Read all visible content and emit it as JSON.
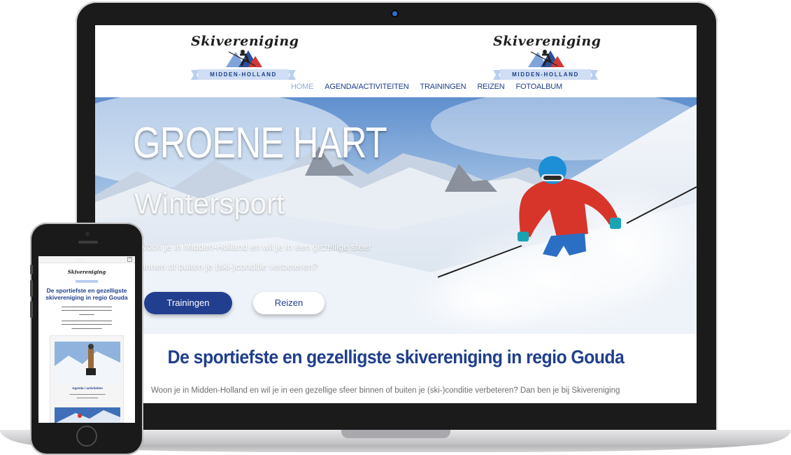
{
  "site": {
    "logo": {
      "name": "Skivereniging",
      "tagline": "MIDDEN-HOLLAND"
    },
    "nav": [
      {
        "label": "HOME",
        "active": true
      },
      {
        "label": "AGENDA/ACTIVITEITEN",
        "active": false
      },
      {
        "label": "TRAININGEN",
        "active": false
      },
      {
        "label": "REIZEN",
        "active": false
      },
      {
        "label": "FOTOALBUM",
        "active": false
      }
    ],
    "hero": {
      "title": "GROENE HART",
      "subtitle": "Wintersport",
      "line1": "Woon je in Midden-Holland en wil je in een gezellige sfeer",
      "line2": "binnen of buiten je (ski-)conditie verbeteren?",
      "button_primary": "Trainingen",
      "button_secondary": "Reizen"
    },
    "content": {
      "heading": "De sportiefste en gezelligste skivereniging in regio Gouda",
      "text": "Woon je in Midden-Holland en wil je in een gezellige sfeer binnen of buiten je (ski-)conditie verbeteren? Dan ben je bij Skivereniging"
    }
  },
  "mobile": {
    "logo_name": "Skivereniging",
    "heading": "De sportiefste en gezelligste skivereniging in regio Gouda",
    "card_title": "Agenda / activiteiten"
  },
  "colors": {
    "brand_blue": "#1f3f8a",
    "nav_active": "#8eaee0",
    "banner_blue": "#b9cfee"
  }
}
